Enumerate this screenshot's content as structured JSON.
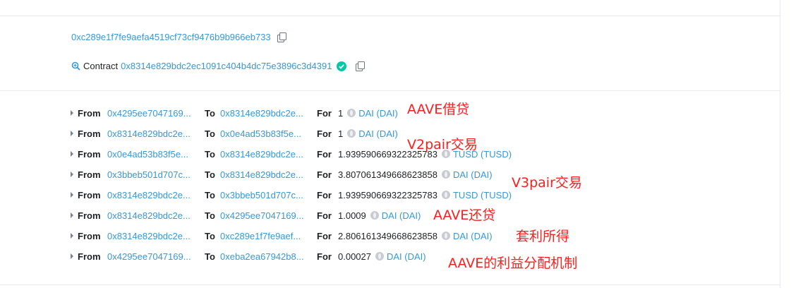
{
  "header": {
    "address": "0xc289e1f7fe9aefa4519cf73cf9476b9b966eb733",
    "contract_label": "Contract",
    "contract_address": "0x8314e829bdc2ec1091c404b4dc75e3896c3d4391"
  },
  "transfers": [
    {
      "from_label": "From",
      "from": "0x4295ee7047169...",
      "to_label": "To",
      "to": "0x8314e829bdc2e...",
      "for_label": "For",
      "amount": "1",
      "token": "DAI (DAI)"
    },
    {
      "from_label": "From",
      "from": "0x8314e829bdc2e...",
      "to_label": "To",
      "to": "0x0e4ad53b83f5e...",
      "for_label": "For",
      "amount": "1",
      "token": "DAI (DAI)"
    },
    {
      "from_label": "From",
      "from": "0x0e4ad53b83f5e...",
      "to_label": "To",
      "to": "0x8314e829bdc2e...",
      "for_label": "For",
      "amount": "1.939590669322325783",
      "token": "TUSD (TUSD)"
    },
    {
      "from_label": "From",
      "from": "0x3bbeb501d707c...",
      "to_label": "To",
      "to": "0x8314e829bdc2e...",
      "for_label": "For",
      "amount": "3.807061349668623858",
      "token": "DAI (DAI)"
    },
    {
      "from_label": "From",
      "from": "0x8314e829bdc2e...",
      "to_label": "To",
      "to": "0x3bbeb501d707c...",
      "for_label": "For",
      "amount": "1.939590669322325783",
      "token": "TUSD (TUSD)"
    },
    {
      "from_label": "From",
      "from": "0x8314e829bdc2e...",
      "to_label": "To",
      "to": "0x4295ee7047169...",
      "for_label": "For",
      "amount": "1.0009",
      "token": "DAI (DAI)"
    },
    {
      "from_label": "From",
      "from": "0x8314e829bdc2e...",
      "to_label": "To",
      "to": "0xc289e1f7fe9aef...",
      "for_label": "For",
      "amount": "2.806161349668623858",
      "token": "DAI (DAI)"
    },
    {
      "from_label": "From",
      "from": "0x4295ee7047169...",
      "to_label": "To",
      "to": "0xeba2ea67942b8...",
      "for_label": "For",
      "amount": "0.00027",
      "token": "DAI (DAI)"
    }
  ],
  "annotations": {
    "aave_borrow": "AAVE借贷",
    "v2pair_trade": "V2pair交易",
    "v3pair_trade": "V3pair交易",
    "aave_repay": "AAVE还贷",
    "arbitrage_profit": "套利所得",
    "aave_fee": "AAVE的利益分配机制"
  },
  "colors": {
    "link": "#3498db",
    "annotation": "#ff1e1e",
    "verified": "#00c9a7"
  }
}
